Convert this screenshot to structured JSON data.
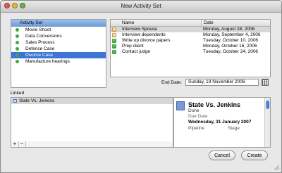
{
  "window": {
    "title": "New Activity Set"
  },
  "activity_sets": {
    "header": "Activity Set",
    "items": [
      {
        "label": "Movie Shoot",
        "selected": false
      },
      {
        "label": "Data Conversions",
        "selected": false
      },
      {
        "label": "Sales Process",
        "selected": false
      },
      {
        "label": "Defence Case",
        "selected": false
      },
      {
        "label": "Divorce Case",
        "selected": true
      },
      {
        "label": "Manufacture hearings",
        "selected": false
      }
    ]
  },
  "activities": {
    "columns": {
      "name": "Name",
      "date": "Date"
    },
    "rows": [
      {
        "name": "Interview Spouse",
        "date": "Monday, August 28, 2006",
        "icon": "calendar-icon",
        "icon_color": "#c7962e",
        "selected": true
      },
      {
        "name": "Interview dependents",
        "date": "Monday, September 4, 2006",
        "icon": "calendar-icon",
        "icon_color": "#c7962e",
        "selected": false
      },
      {
        "name": "Write up divorce papers",
        "date": "Tuesday, October 10, 2006",
        "icon": "check-icon",
        "icon_color": "#3fa844",
        "selected": false
      },
      {
        "name": "Prep client",
        "date": "Monday, October 16, 2006",
        "icon": "check-icon",
        "icon_color": "#3fa844",
        "selected": false
      },
      {
        "name": "Contact judge",
        "date": "Tuesday, October 24, 2006",
        "icon": "check-icon",
        "icon_color": "#3fa844",
        "selected": false
      }
    ]
  },
  "end_date": {
    "label": "End Date:",
    "value": "Sunday, 19 November 2006"
  },
  "linked": {
    "label": "Linked",
    "items": [
      {
        "label": "State Vs. Jenkins"
      }
    ],
    "add_label": "+",
    "remove_label": "−"
  },
  "detail": {
    "title": "State Vs. Jenkins",
    "status": "Done",
    "due_label": "Due Date",
    "due_value": "Wednesday, 31 January 2007",
    "col1": "Pipeline",
    "col2": "Stage"
  },
  "buttons": {
    "cancel": "Cancel",
    "create": "Create"
  },
  "colors": {
    "selection": "#3d75d6",
    "accent_green": "#3fa844"
  }
}
